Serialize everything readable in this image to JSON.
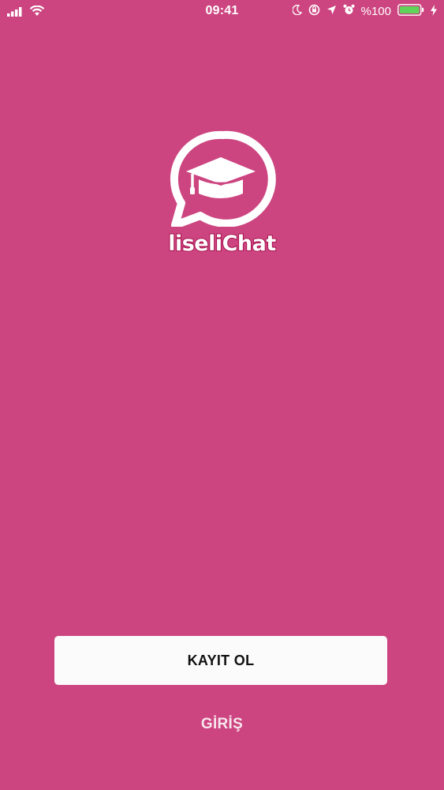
{
  "status_bar": {
    "time": "09:41",
    "battery_text": "%100",
    "icons": [
      "signal-icon",
      "wifi-icon",
      "moon-icon",
      "rotation-lock-icon",
      "location-icon",
      "alarm-icon",
      "battery-icon",
      "charging-icon"
    ]
  },
  "app": {
    "name": "liseliChat",
    "logo_icon": "chat-graduation-cap-icon"
  },
  "actions": {
    "register_label": "KAYIT OL",
    "login_label": "GİRİŞ"
  },
  "colors": {
    "background": "#cd4580",
    "button_bg": "#fbfbfc",
    "button_text": "#111111",
    "logo_outline": "#a8124f"
  }
}
